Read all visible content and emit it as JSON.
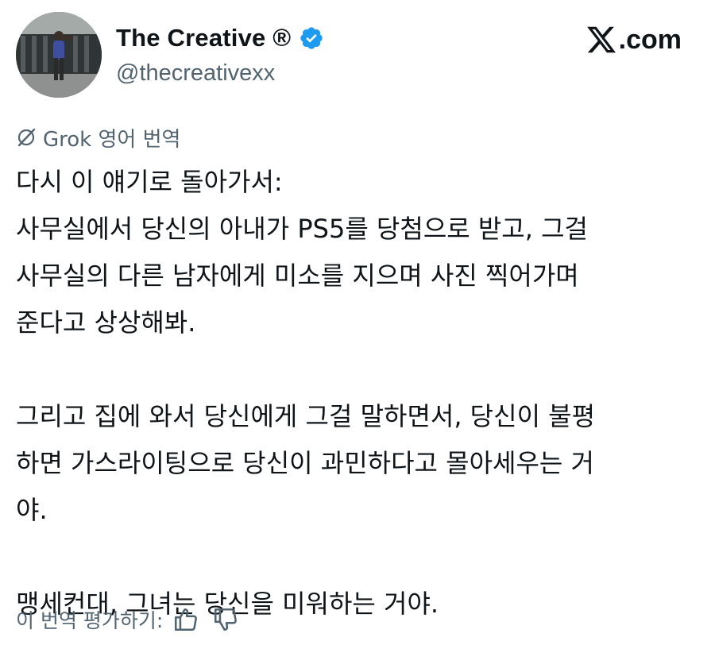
{
  "header": {
    "display_name": "The Creative ®",
    "handle": "@thecreativexx",
    "brand": "X.com",
    "brand_suffix": ".com"
  },
  "translation": {
    "label": "Grok 영어 번역"
  },
  "tweet": {
    "paragraph1": [
      "다시 이 얘기로 돌아가서:",
      "사무실에서 당신의 아내가 PS5를 당첨으로 받고, 그걸",
      "사무실의 다른 남자에게 미소를 지으며 사진 찍어가며",
      "준다고 상상해봐."
    ],
    "paragraph2": [
      "그리고 집에 와서 당신에게 그걸 말하면서, 당신이 불평",
      "하면 가스라이팅으로 당신이 과민하다고 몰아세우는 거",
      "야."
    ],
    "paragraph3": [
      "맹세컨대, 그녀는 당신을 미워하는 거야."
    ]
  },
  "rating": {
    "label": "이 번역 평가하기:"
  },
  "icons": {
    "verified": "verified-badge-icon",
    "translate": "grok-slash-icon",
    "like": "thumbs-up-icon",
    "dislike": "thumbs-down-icon",
    "brand": "x-logo-icon"
  },
  "colors": {
    "verified": "#1d9bf0",
    "secondary_text": "#536471",
    "primary_text": "#0f1419"
  }
}
